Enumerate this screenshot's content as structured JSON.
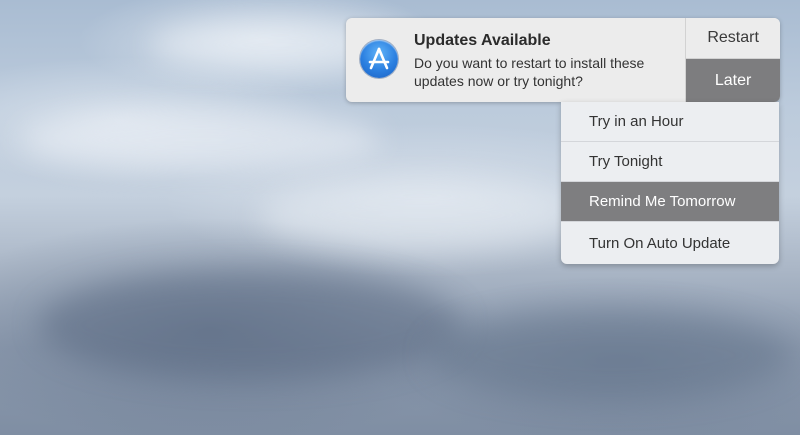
{
  "colors": {
    "later_button_bg": "#7d7d7f",
    "selected_menu_bg": "#7e7e80",
    "banner_bg": "#ececec",
    "app_icon_blue": "#2b7fe0"
  },
  "notification": {
    "app_icon": "app-store-icon",
    "title": "Updates Available",
    "body": "Do you want to restart to install these updates now or try tonight?",
    "restart_label": "Restart",
    "later_label": "Later"
  },
  "later_menu": {
    "items": [
      {
        "label": "Try in an Hour",
        "selected": false
      },
      {
        "label": "Try Tonight",
        "selected": false
      },
      {
        "label": "Remind Me Tomorrow",
        "selected": true
      },
      {
        "label": "Turn On Auto Update",
        "selected": false
      }
    ]
  }
}
